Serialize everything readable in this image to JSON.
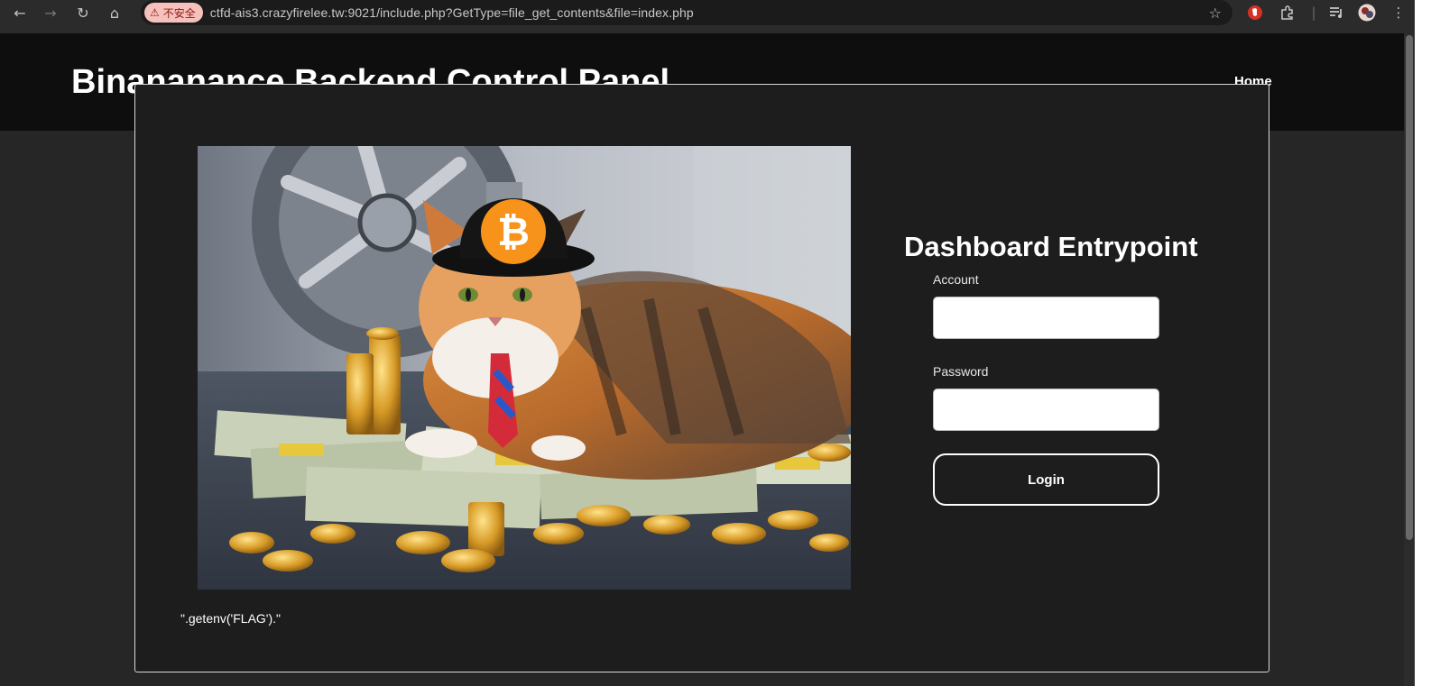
{
  "browser": {
    "security_chip": "不安全",
    "url": "ctfd-ais3.crazyfirelee.tw:9021/include.php?GetType=file_get_contents&file=index.php",
    "icons": [
      "back-icon",
      "forward-icon",
      "reload-icon",
      "home-icon",
      "warning-icon",
      "star-icon",
      "extension-red-icon",
      "puzzle-icon",
      "media-icon",
      "profile-avatar",
      "more-icon"
    ]
  },
  "header": {
    "title": "Binananance Backend Control Panel",
    "nav_home": "Home"
  },
  "modal": {
    "image_desc": "cat-with-bitcoin-hat",
    "code_text": "\".getenv('FLAG').\"",
    "login": {
      "title": "Dashboard Entrypoint",
      "account_label": "Account",
      "account_value": "",
      "password_label": "Password",
      "password_value": "",
      "button_label": "Login"
    }
  },
  "colors": {
    "chrome_bg": "#2b2b2b",
    "header_bg": "#0e0e0e",
    "page_bg": "#262626",
    "modal_bg": "#1d1d1d",
    "bitcoin_orange": "#f7931a"
  }
}
